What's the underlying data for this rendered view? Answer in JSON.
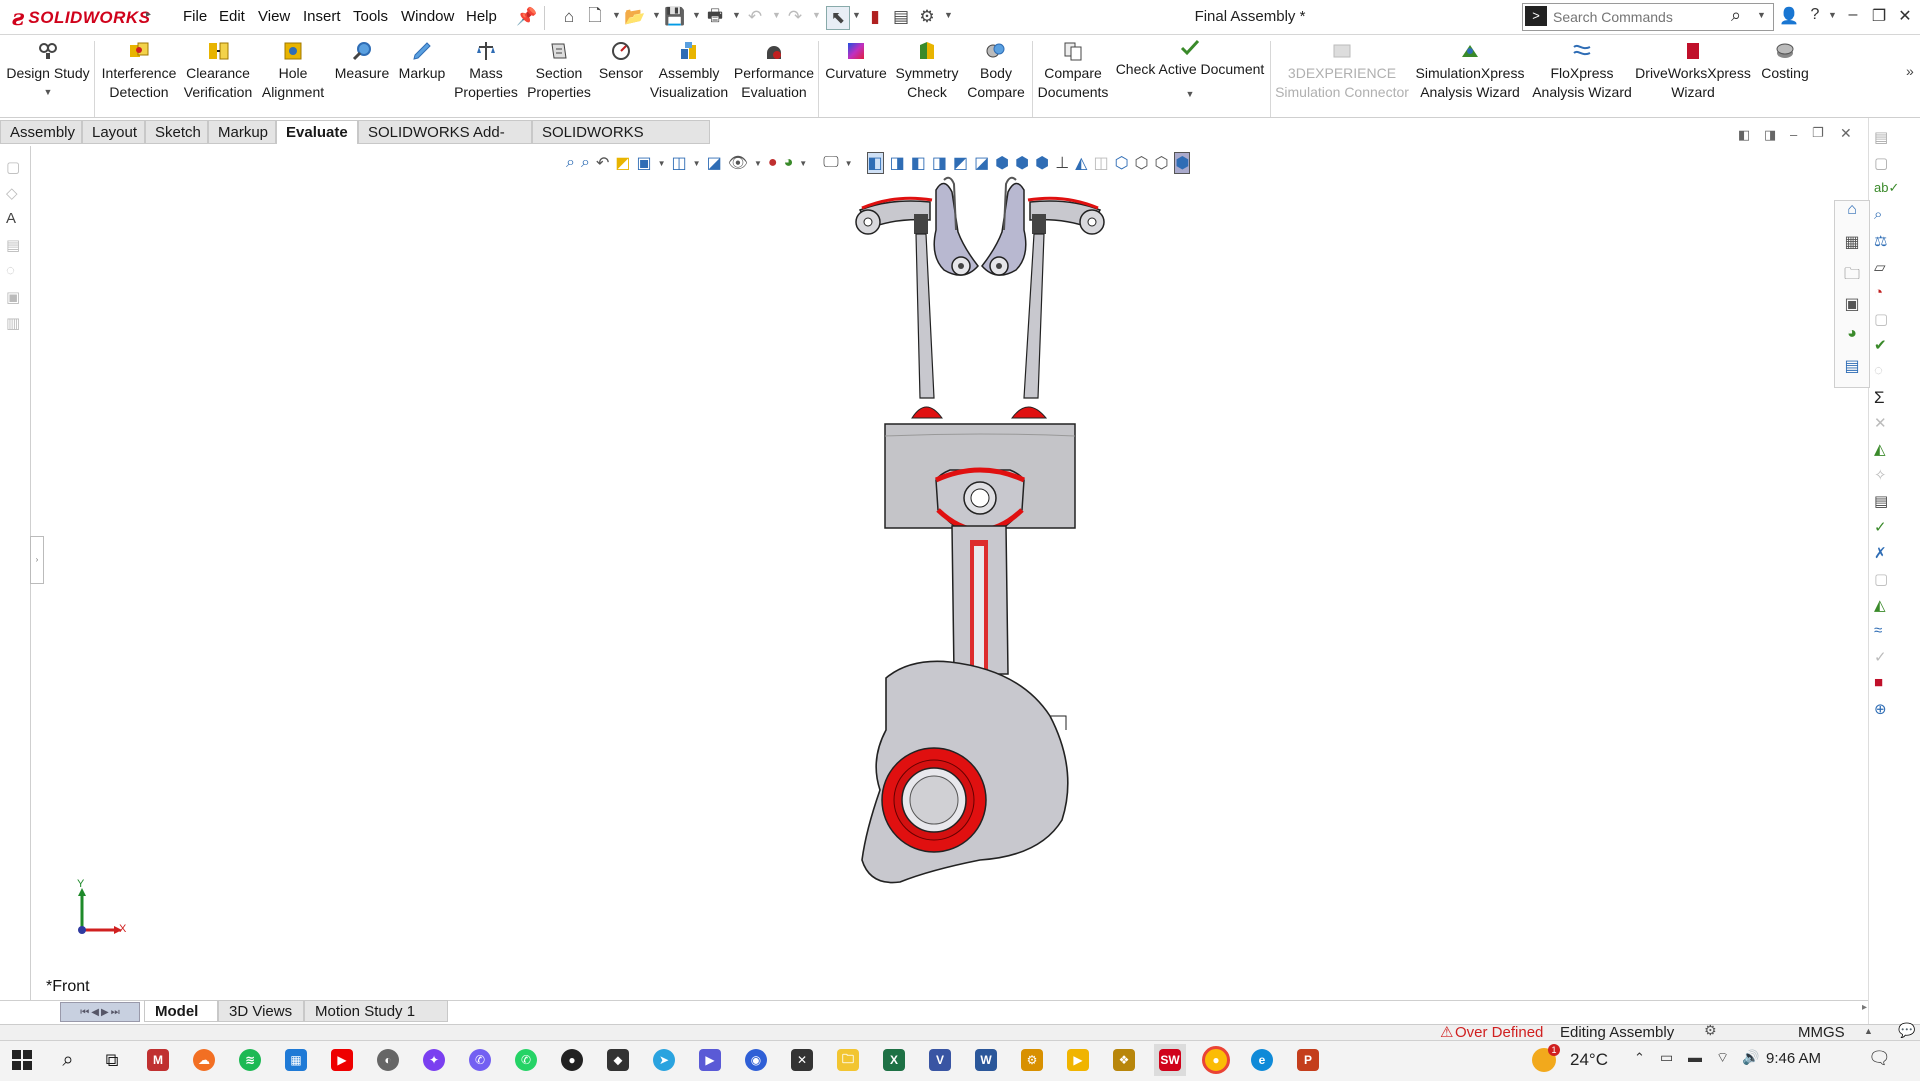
{
  "app": {
    "name": "SOLIDWORKS",
    "document_title": "Final Assembly *"
  },
  "menu": [
    "File",
    "Edit",
    "View",
    "Insert",
    "Tools",
    "Window",
    "Help"
  ],
  "search": {
    "placeholder": "Search Commands"
  },
  "ribbon": {
    "items": [
      {
        "label1": "Design Study",
        "label2": "",
        "icon": "design-study-icon",
        "color": "#4a4a4a"
      },
      {
        "label1": "Interference",
        "label2": "Detection",
        "icon": "interference-detection-icon",
        "color": "#d8a400"
      },
      {
        "label1": "Clearance",
        "label2": "Verification",
        "icon": "clearance-verification-icon",
        "color": "#d8a400"
      },
      {
        "label1": "Hole",
        "label2": "Alignment",
        "icon": "hole-alignment-icon",
        "color": "#d8a400"
      },
      {
        "label1": "Measure",
        "label2": "",
        "icon": "measure-icon",
        "color": "#2f6db5"
      },
      {
        "label1": "Markup",
        "label2": "",
        "icon": "markup-icon",
        "color": "#2f6db5"
      },
      {
        "label1": "Mass",
        "label2": "Properties",
        "icon": "mass-properties-icon",
        "color": "#2f6db5"
      },
      {
        "label1": "Section",
        "label2": "Properties",
        "icon": "section-properties-icon",
        "color": "#555555"
      },
      {
        "label1": "Sensor",
        "label2": "",
        "icon": "sensor-icon",
        "color": "#555555"
      },
      {
        "label1": "Assembly",
        "label2": "Visualization",
        "icon": "assembly-visualization-icon",
        "color": "#2f6db5"
      },
      {
        "label1": "Performance",
        "label2": "Evaluation",
        "icon": "performance-evaluation-icon",
        "color": "#b02020"
      },
      {
        "label1": "Curvature",
        "label2": "",
        "icon": "curvature-icon",
        "color": "#c03090"
      },
      {
        "label1": "Symmetry",
        "label2": "Check",
        "icon": "symmetry-check-icon",
        "color": "#3a8a2a"
      },
      {
        "label1": "Body",
        "label2": "Compare",
        "icon": "body-compare-icon",
        "color": "#555555"
      },
      {
        "label1": "Compare",
        "label2": "Documents",
        "icon": "compare-documents-icon",
        "color": "#555555"
      },
      {
        "label1": "Check Active Document",
        "label2": "",
        "icon": "check-active-document-icon",
        "color": "#3a8a2a"
      },
      {
        "label1": "3DEXPERIENCE",
        "label2": "Simulation Connector",
        "icon": "3dexperience-connector-icon",
        "color": "#b0b0b0"
      },
      {
        "label1": "SimulationXpress",
        "label2": "Analysis Wizard",
        "icon": "simulationxpress-icon",
        "color": "#3a8a2a"
      },
      {
        "label1": "FloXpress",
        "label2": "Analysis Wizard",
        "icon": "floxpress-icon",
        "color": "#2f6db5"
      },
      {
        "label1": "DriveWorksXpress",
        "label2": "Wizard",
        "icon": "driveworksxpress-icon",
        "color": "#c0102a"
      },
      {
        "label1": "Costing",
        "label2": "",
        "icon": "costing-icon",
        "color": "#555555"
      }
    ]
  },
  "tabs": [
    "Assembly",
    "Layout",
    "Sketch",
    "Markup",
    "Evaluate",
    "SOLIDWORKS Add-Ins",
    "SOLIDWORKS Visualize"
  ],
  "active_tab": "Evaluate",
  "viewport": {
    "view_label": "*Front",
    "axis_x": "X",
    "axis_y": "Y"
  },
  "bottom_tabs": [
    "Model",
    "3D Views",
    "Motion Study 1"
  ],
  "status": {
    "warning": "Over Defined",
    "mode": "Editing Assembly",
    "units": "MMGS"
  },
  "taskbar": {
    "temperature": "24°C",
    "time": "9:46 AM",
    "notification_count": "1"
  },
  "colors": {
    "accent_red": "#d0021b",
    "part_red": "#e01010",
    "part_gray": "#c8c8ce"
  }
}
